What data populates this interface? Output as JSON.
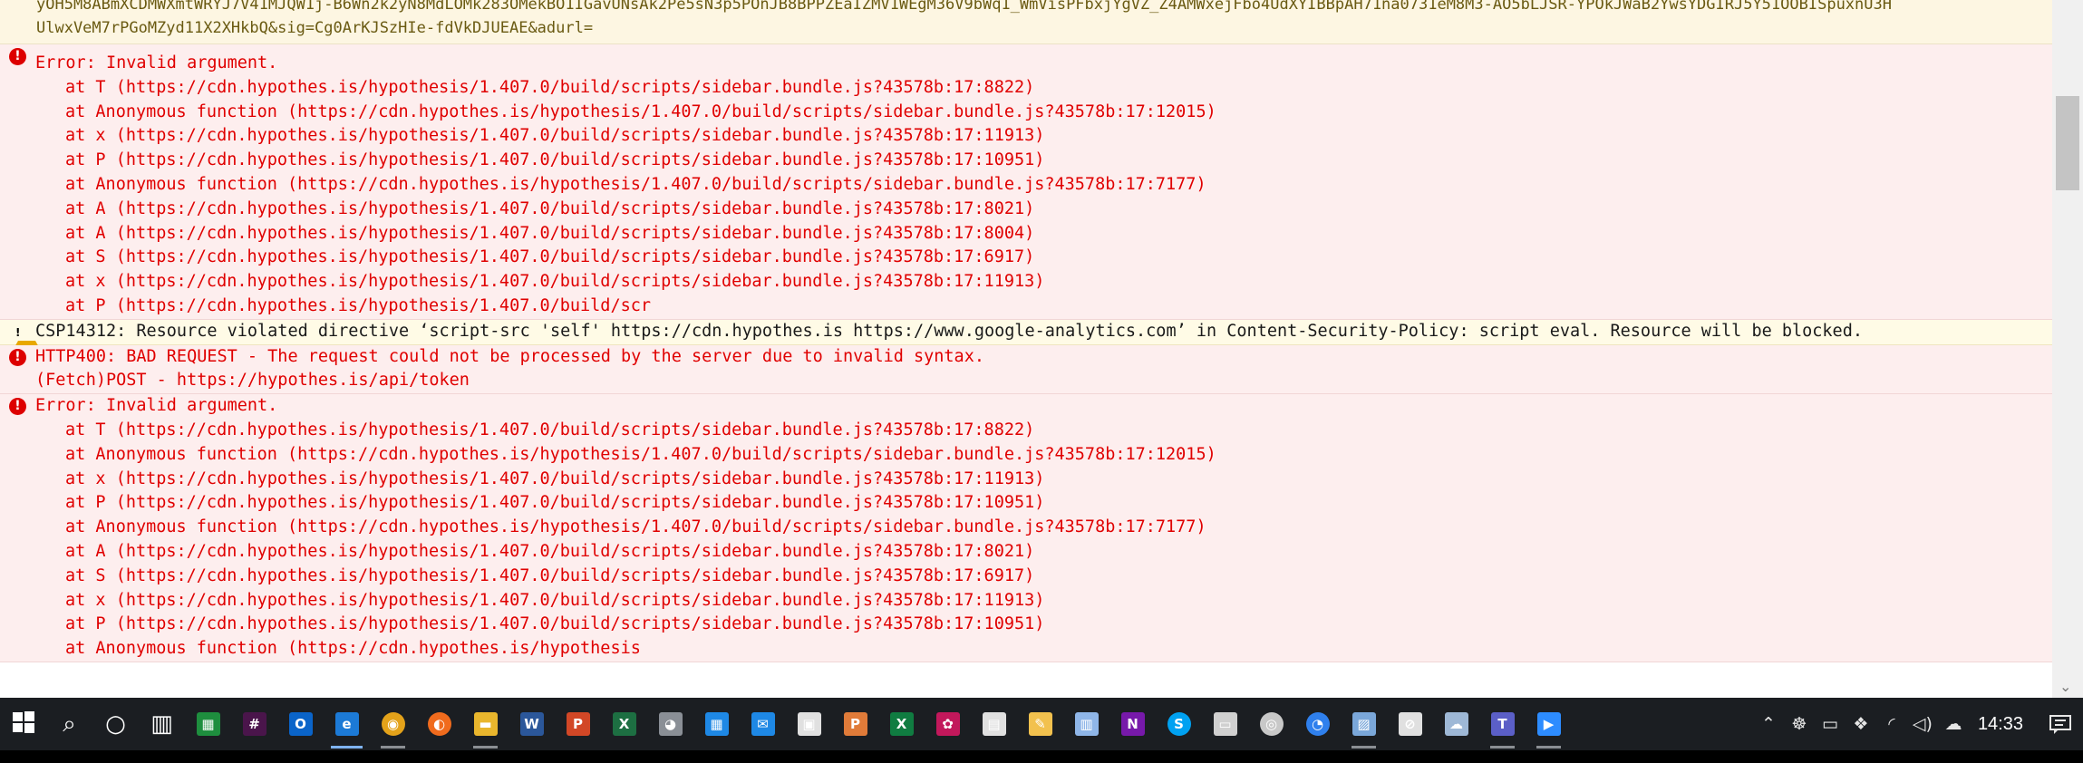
{
  "console": {
    "top_entry": {
      "lines": [
        "yOH5M8ABmXCDMWXmtWRYJ7V41MJQW1j-B6Wn2k2yN8MdLOMk283OMekBO1IGavUNsAk2Pe5sN3p5POnJB8BPPZEaIZMV1WEgM36V9bWq1_WmVisPFbxjYgVZ_Z4AMWxejFbo4UdXYIBBpAH71na0731eM8M3-AO5bLJSR-YPOkJWaB2YwsYDGIRJ5Y51OOBISpuxnU3H",
        "UlwxVeM7rPGoMZyd11X2XHkbQ&sig=Cg0ArKJSzHIe-fdVkDJUEAE&adurl="
      ]
    },
    "entries": [
      {
        "type": "error",
        "lines": [
          "Error: Invalid argument.",
          "at T (https://cdn.hypothes.is/hypothesis/1.407.0/build/scripts/sidebar.bundle.js?43578b:17:8822)",
          "at Anonymous function (https://cdn.hypothes.is/hypothesis/1.407.0/build/scripts/sidebar.bundle.js?43578b:17:12015)",
          "at x (https://cdn.hypothes.is/hypothesis/1.407.0/build/scripts/sidebar.bundle.js?43578b:17:11913)",
          "at P (https://cdn.hypothes.is/hypothesis/1.407.0/build/scripts/sidebar.bundle.js?43578b:17:10951)",
          "at Anonymous function (https://cdn.hypothes.is/hypothesis/1.407.0/build/scripts/sidebar.bundle.js?43578b:17:7177)",
          "at A (https://cdn.hypothes.is/hypothesis/1.407.0/build/scripts/sidebar.bundle.js?43578b:17:8021)",
          "at A (https://cdn.hypothes.is/hypothesis/1.407.0/build/scripts/sidebar.bundle.js?43578b:17:8004)",
          "at S (https://cdn.hypothes.is/hypothesis/1.407.0/build/scripts/sidebar.bundle.js?43578b:17:6917)",
          "at x (https://cdn.hypothes.is/hypothesis/1.407.0/build/scripts/sidebar.bundle.js?43578b:17:11913)",
          "at P (https://cdn.hypothes.is/hypothesis/1.407.0/build/scr"
        ]
      },
      {
        "type": "warning",
        "lines": [
          "CSP14312: Resource violated directive ‘script-src 'self' https://cdn.hypothes.is https://www.google-analytics.com’ in Content-Security-Policy: script eval. Resource will be blocked."
        ]
      },
      {
        "type": "error",
        "lines": [
          "HTTP400: BAD REQUEST - The request could not be processed by the server due to invalid syntax.",
          "(Fetch)POST - https://hypothes.is/api/token"
        ]
      },
      {
        "type": "error",
        "lines": [
          "Error: Invalid argument.",
          "at T (https://cdn.hypothes.is/hypothesis/1.407.0/build/scripts/sidebar.bundle.js?43578b:17:8822)",
          "at Anonymous function (https://cdn.hypothes.is/hypothesis/1.407.0/build/scripts/sidebar.bundle.js?43578b:17:12015)",
          "at x (https://cdn.hypothes.is/hypothesis/1.407.0/build/scripts/sidebar.bundle.js?43578b:17:11913)",
          "at P (https://cdn.hypothes.is/hypothesis/1.407.0/build/scripts/sidebar.bundle.js?43578b:17:10951)",
          "at Anonymous function (https://cdn.hypothes.is/hypothesis/1.407.0/build/scripts/sidebar.bundle.js?43578b:17:7177)",
          "at A (https://cdn.hypothes.is/hypothesis/1.407.0/build/scripts/sidebar.bundle.js?43578b:17:8021)",
          "at S (https://cdn.hypothes.is/hypothesis/1.407.0/build/scripts/sidebar.bundle.js?43578b:17:6917)",
          "at x (https://cdn.hypothes.is/hypothesis/1.407.0/build/scripts/sidebar.bundle.js?43578b:17:11913)",
          "at P (https://cdn.hypothes.is/hypothesis/1.407.0/build/scripts/sidebar.bundle.js?43578b:17:10951)",
          "at Anonymous function (https://cdn.hypothes.is/hypothesis"
        ]
      }
    ]
  },
  "taskbar": {
    "apps": [
      {
        "name": "start-button",
        "icon": "windows-logo-icon",
        "glyph": "",
        "color": "#ffffff"
      },
      {
        "name": "search-button",
        "icon": "search-icon",
        "glyph": "⌕",
        "color": "#ffffff"
      },
      {
        "name": "cortana-button",
        "icon": "cortana-ring-icon",
        "glyph": "○",
        "color": "#ffffff"
      },
      {
        "name": "task-view-button",
        "icon": "task-view-icon",
        "glyph": "▥",
        "color": "#ffffff"
      },
      {
        "name": "app-spreadsheet",
        "icon": "spreadsheet-icon",
        "glyph": "▦",
        "color": "#1e8e3e"
      },
      {
        "name": "app-slack",
        "icon": "slack-icon",
        "glyph": "#",
        "color": "#4a154b"
      },
      {
        "name": "app-outlook",
        "icon": "outlook-icon",
        "glyph": "O",
        "color": "#0a64c9"
      },
      {
        "name": "app-edge",
        "icon": "edge-icon",
        "glyph": "e",
        "color": "#1c7ad6"
      },
      {
        "name": "app-chrome",
        "icon": "chrome-icon",
        "glyph": "◉",
        "color": "#e3a21a"
      },
      {
        "name": "app-firefox",
        "icon": "firefox-icon",
        "glyph": "◐",
        "color": "#f06b1d"
      },
      {
        "name": "app-file-explorer",
        "icon": "folder-icon",
        "glyph": "▬",
        "color": "#e9b62d"
      },
      {
        "name": "app-word",
        "icon": "word-icon",
        "glyph": "W",
        "color": "#2b579a"
      },
      {
        "name": "app-powerpoint",
        "icon": "powerpoint-icon",
        "glyph": "P",
        "color": "#d24726"
      },
      {
        "name": "app-excel",
        "icon": "excel-icon",
        "glyph": "X",
        "color": "#1d6f42"
      },
      {
        "name": "app-ghost",
        "icon": "ghost-icon",
        "glyph": "◕",
        "color": "#8a8f96"
      },
      {
        "name": "app-calendar",
        "icon": "calendar-icon",
        "glyph": "▦",
        "color": "#1e88e5"
      },
      {
        "name": "app-mail",
        "icon": "mail-icon",
        "glyph": "✉",
        "color": "#1e88e5"
      },
      {
        "name": "app-store",
        "icon": "store-icon",
        "glyph": "▣",
        "color": "#e0e0e0"
      },
      {
        "name": "app-publisher",
        "icon": "publisher-icon",
        "glyph": "P",
        "color": "#e07b39"
      },
      {
        "name": "app-excel-2",
        "icon": "excel-icon",
        "glyph": "X",
        "color": "#107c41"
      },
      {
        "name": "app-paint",
        "icon": "paint-icon",
        "glyph": "✿",
        "color": "#c2185b"
      },
      {
        "name": "app-calculator",
        "icon": "calculator-icon",
        "glyph": "▤",
        "color": "#e0e0e0"
      },
      {
        "name": "app-notepad",
        "icon": "notepad-icon",
        "glyph": "✎",
        "color": "#f2c14e"
      },
      {
        "name": "app-notes",
        "icon": "notes-icon",
        "glyph": "▥",
        "color": "#8fb6e8"
      },
      {
        "name": "app-onenote",
        "icon": "onenote-icon",
        "glyph": "N",
        "color": "#7719aa"
      },
      {
        "name": "app-skype",
        "icon": "skype-icon",
        "glyph": "S",
        "color": "#00a1f1"
      },
      {
        "name": "app-remote-desktop",
        "icon": "remote-desktop-icon",
        "glyph": "▭",
        "color": "#d0d0d0"
      },
      {
        "name": "app-media",
        "icon": "media-disc-icon",
        "glyph": "◎",
        "color": "#c8c8c8"
      },
      {
        "name": "app-gauge",
        "icon": "gauge-icon",
        "glyph": "◔",
        "color": "#2f80ed"
      },
      {
        "name": "app-photos",
        "icon": "photos-icon",
        "glyph": "▨",
        "color": "#7aa7d9"
      },
      {
        "name": "app-blocker",
        "icon": "blocked-icon",
        "glyph": "⊘",
        "color": "#e0e0e0"
      },
      {
        "name": "app-cloud-sync",
        "icon": "cloud-icon",
        "glyph": "☁",
        "color": "#9eb8d6"
      },
      {
        "name": "app-teams",
        "icon": "teams-icon",
        "glyph": "T",
        "color": "#5b5fc7"
      },
      {
        "name": "app-zoom",
        "icon": "zoom-icon",
        "glyph": "▶",
        "color": "#2d8cff"
      }
    ],
    "tray": [
      {
        "name": "tray-overflow",
        "icon": "chevron-up-icon",
        "glyph": "⌃"
      },
      {
        "name": "tray-people",
        "icon": "people-icon",
        "glyph": "☸"
      },
      {
        "name": "tray-battery",
        "icon": "battery-icon",
        "glyph": "▭"
      },
      {
        "name": "tray-dropbox",
        "icon": "dropbox-icon",
        "glyph": "❖"
      },
      {
        "name": "tray-wifi",
        "icon": "wifi-icon",
        "glyph": "◜"
      },
      {
        "name": "tray-volume",
        "icon": "volume-icon",
        "glyph": "◁)"
      },
      {
        "name": "tray-onedrive",
        "icon": "onedrive-cloud-icon",
        "glyph": "☁"
      }
    ],
    "clock": "14:33",
    "notification_icon": "notification-icon"
  }
}
